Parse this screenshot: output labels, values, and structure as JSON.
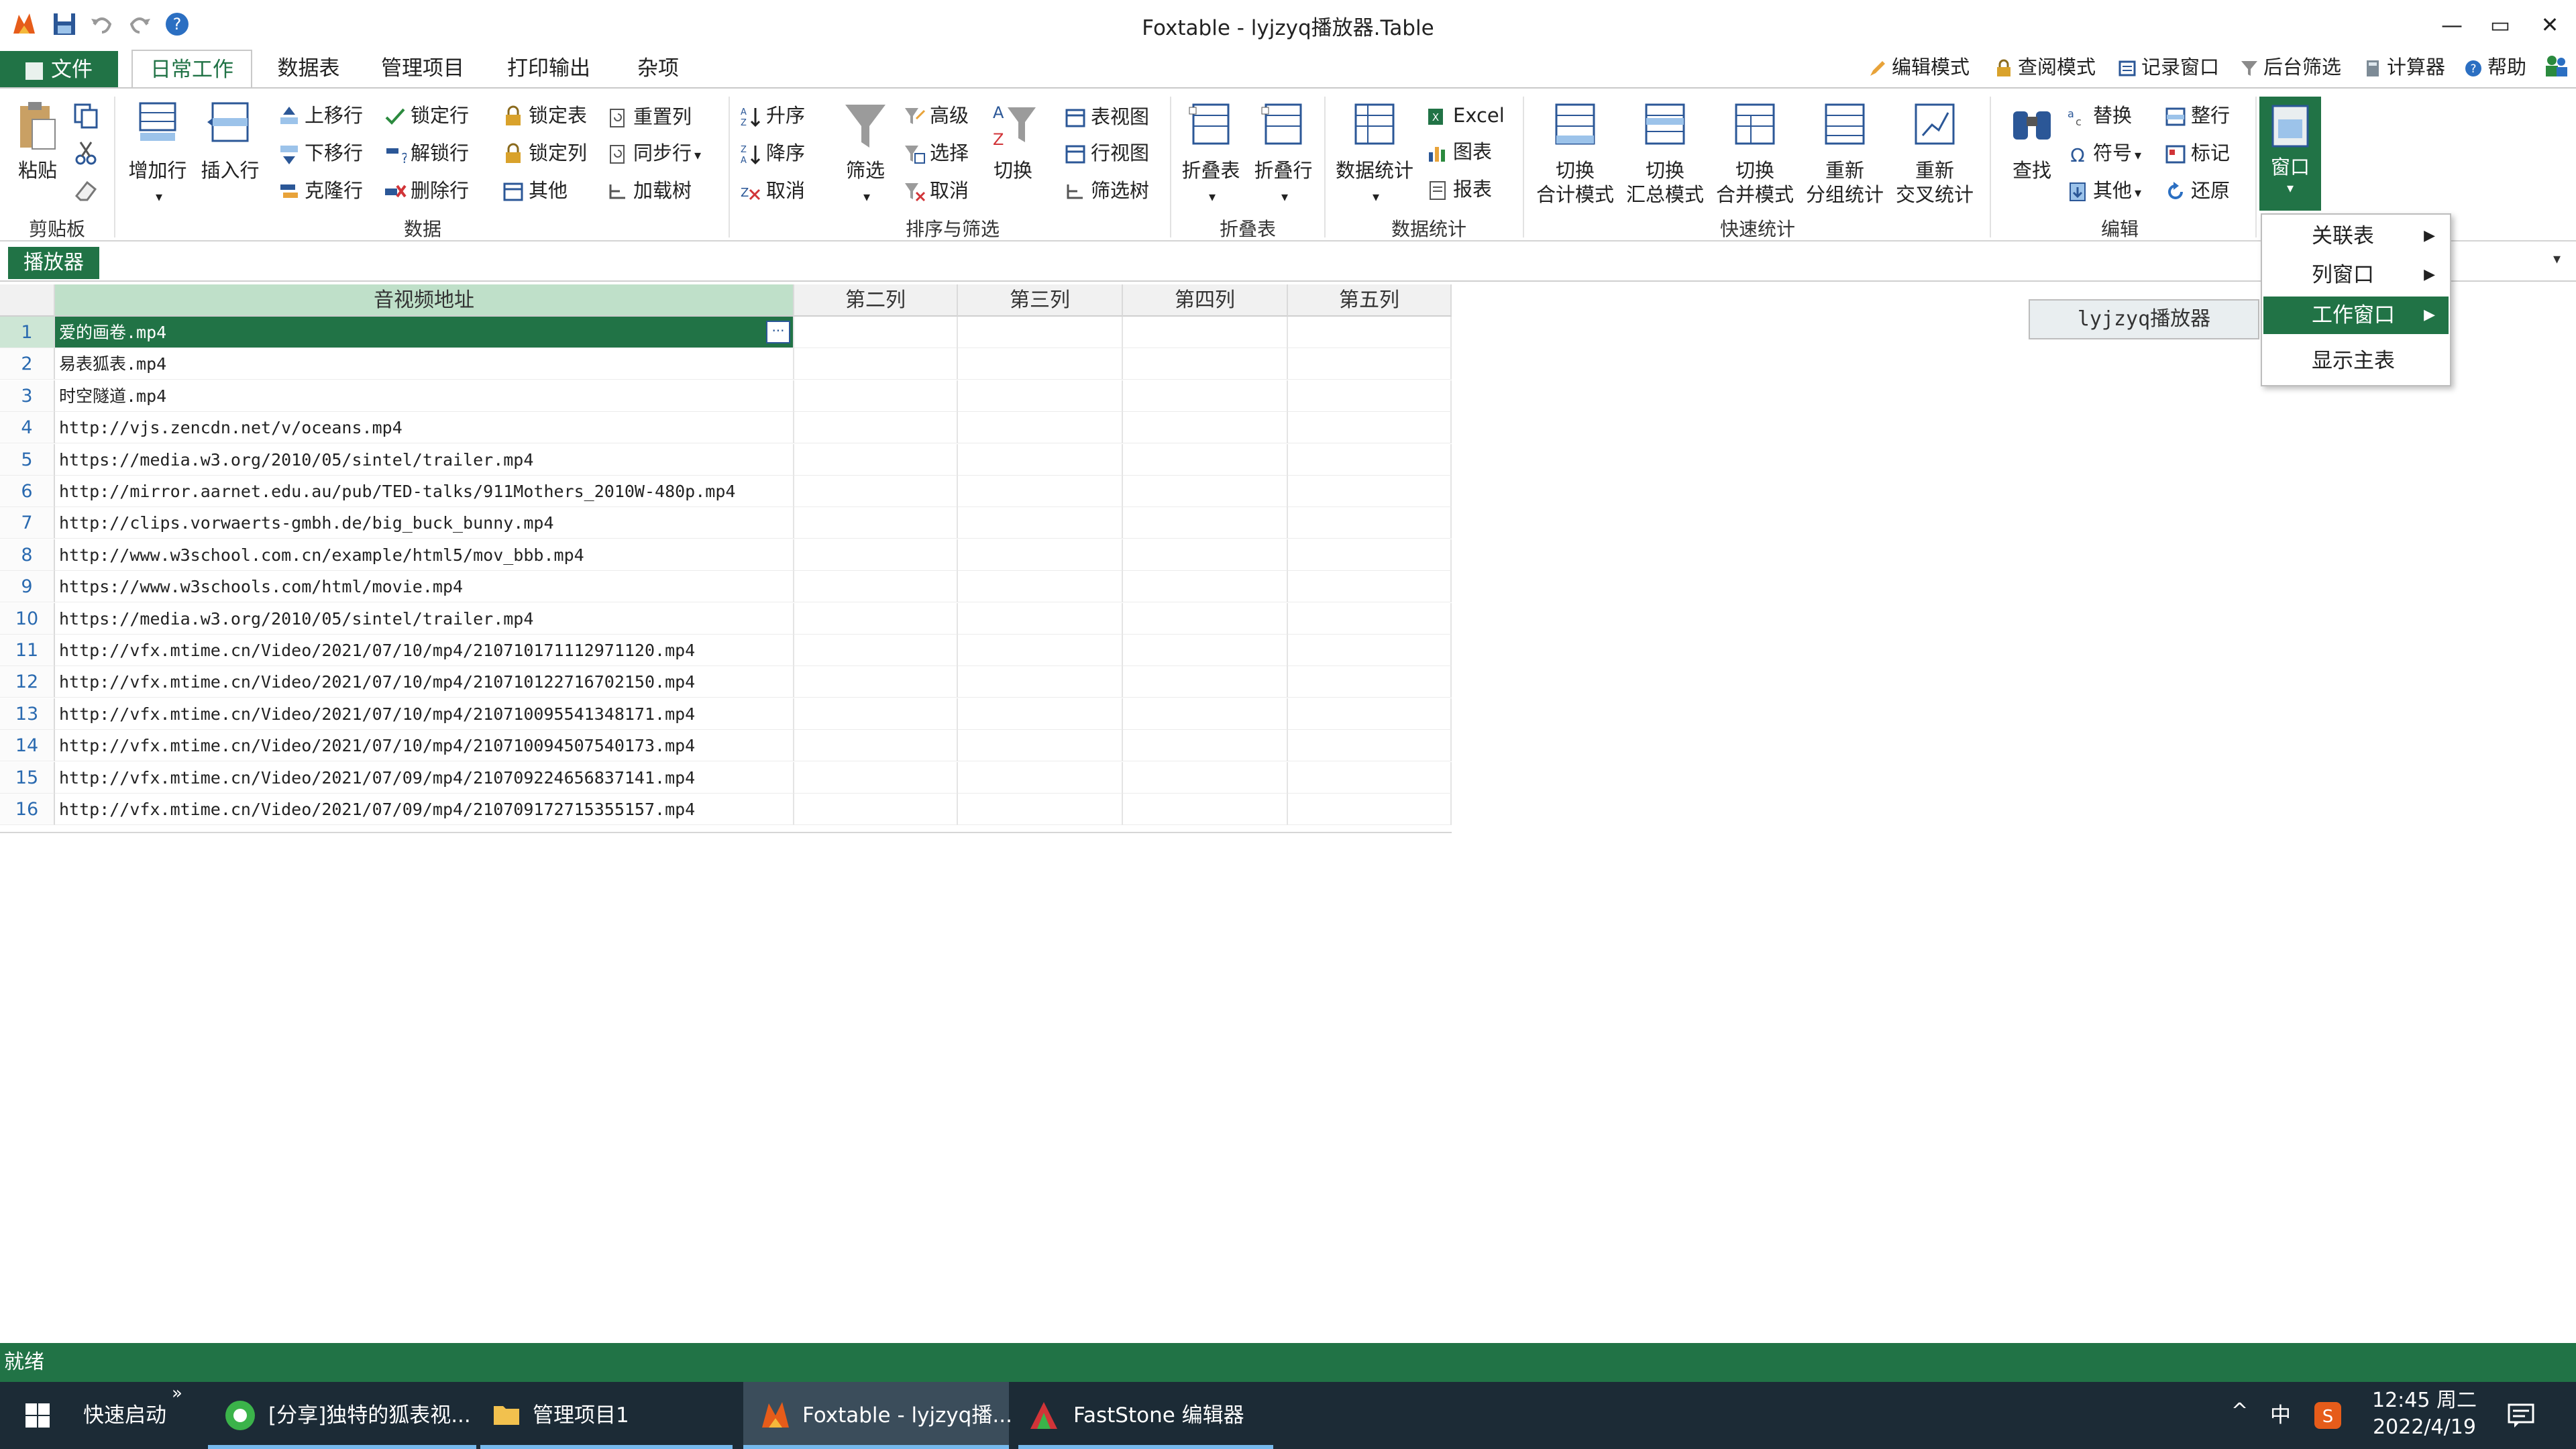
{
  "window": {
    "title": "Foxtable - lyjzyq播放器.Table",
    "minimize": "—",
    "restore": "▭",
    "close": "✕"
  },
  "menu_tabs": {
    "file": "文件",
    "tabs": [
      "日常工作",
      "数据表",
      "管理项目",
      "打印输出",
      "杂项"
    ]
  },
  "toolbar_right": [
    "编辑模式",
    "查阅模式",
    "记录窗口",
    "后台筛选",
    "计算器",
    "帮助"
  ],
  "ribbon": {
    "groups": [
      "剪贴板",
      "数据",
      "排序与筛选",
      "折叠表",
      "数据统计",
      "快速统计",
      "编辑"
    ],
    "clipboard": {
      "paste": "粘贴"
    },
    "data": {
      "add_row": "增加行",
      "insert_row": "插入行",
      "col1": [
        "上移行",
        "下移行",
        "克隆行"
      ],
      "col2": [
        "锁定行",
        "解锁行",
        "删除行"
      ],
      "col3": [
        "锁定表",
        "锁定列",
        "其他"
      ],
      "col4": [
        "重置列",
        "同步行",
        "加载树"
      ]
    },
    "sort": {
      "asc": "升序",
      "desc": "降序",
      "cancel": "取消",
      "filter": "筛选",
      "adv": [
        "高级",
        "选择",
        "取消"
      ],
      "switch": "切换",
      "views": [
        "表视图",
        "行视图",
        "筛选树"
      ]
    },
    "fold": {
      "fold_table": "折叠表",
      "fold_row": "折叠行"
    },
    "stats": {
      "data_stats": "数据统计",
      "side": [
        "Excel",
        "图表",
        "报表"
      ]
    },
    "quick": [
      {
        "line1": "切换",
        "line2": "合计模式"
      },
      {
        "line1": "切换",
        "line2": "汇总模式"
      },
      {
        "line1": "切换",
        "line2": "合并模式"
      },
      {
        "line1": "重新",
        "line2": "分组统计"
      },
      {
        "line1": "重新",
        "line2": "交叉统计"
      }
    ],
    "edit": {
      "find": "查找",
      "col1": [
        "替换",
        "符号",
        "其他"
      ],
      "col2": [
        "整行",
        "标记",
        "还原"
      ],
      "window": "窗口"
    }
  },
  "sheet_tab": "播放器",
  "grid": {
    "columns": [
      "音视频地址",
      "第二列",
      "第三列",
      "第四列",
      "第五列"
    ],
    "rows": [
      "爱的画卷.mp4",
      "易表狐表.mp4",
      "时空隧道.mp4",
      "http://vjs.zencdn.net/v/oceans.mp4",
      "https://media.w3.org/2010/05/sintel/trailer.mp4",
      "http://mirror.aarnet.edu.au/pub/TED-talks/911Mothers_2010W-480p.mp4",
      "http://clips.vorwaerts-gmbh.de/big_buck_bunny.mp4",
      "http://www.w3school.com.cn/example/html5/mov_bbb.mp4",
      "https://www.w3schools.com/html/movie.mp4",
      "https://media.w3.org/2010/05/sintel/trailer.mp4",
      "http://vfx.mtime.cn/Video/2021/07/10/mp4/210710171112971120.mp4",
      "http://vfx.mtime.cn/Video/2021/07/10/mp4/210710122716702150.mp4",
      "http://vfx.mtime.cn/Video/2021/07/10/mp4/210710095541348171.mp4",
      "http://vfx.mtime.cn/Video/2021/07/10/mp4/210710094507540173.mp4",
      "http://vfx.mtime.cn/Video/2021/07/09/mp4/210709224656837141.mp4",
      "http://vfx.mtime.cn/Video/2021/07/09/mp4/210709172715355157.mp4"
    ],
    "selected_row": 1
  },
  "window_menu": {
    "items": [
      "关联表",
      "列窗口",
      "工作窗口",
      "显示主表"
    ],
    "highlighted": "工作窗口",
    "submenu_item": "lyjzyq播放器"
  },
  "status": "就绪",
  "taskbar": {
    "quick_launch": "快速启动",
    "items": [
      "[分享]独特的狐表视...",
      "管理项目1",
      "Foxtable - lyjzyq播...",
      "FastStone 编辑器"
    ],
    "ime": "中",
    "time": "12:45 周二",
    "date": "2022/4/19"
  },
  "colors": {
    "accent": "#217346",
    "menu_highlight": "#217346",
    "taskbar": "#1c2b36"
  }
}
